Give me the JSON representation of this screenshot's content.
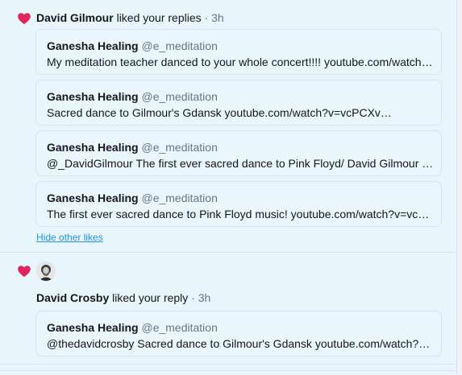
{
  "colors": {
    "background": "#e8f5fd",
    "heart": "#e0245e",
    "link": "#1b95e0",
    "muted": "#657786"
  },
  "notifications": [
    {
      "icon": "heart-icon",
      "user": "David Gilmour",
      "action": "liked your replies",
      "dot": "·",
      "time": "3h",
      "tweets": [
        {
          "name": "Ganesha Healing",
          "handle": "@e_meditation",
          "text": "My meditation teacher danced to your whole concert!!!! youtube.com/watch…"
        },
        {
          "name": "Ganesha Healing",
          "handle": "@e_meditation",
          "text": "Sacred dance to Gilmour's Gdansk youtube.com/watch?v=vcPCXv…"
        },
        {
          "name": "Ganesha Healing",
          "handle": "@e_meditation",
          "text": "@_DavidGilmour The first ever sacred dance to Pink Floyd/ David Gilmour m…"
        },
        {
          "name": "Ganesha Healing",
          "handle": "@e_meditation",
          "text": "The first ever sacred dance to Pink Floyd music! youtube.com/watch?v=vcPC…"
        }
      ],
      "hide_link": "Hide other likes"
    },
    {
      "icon": "heart-icon",
      "avatar": "avatar",
      "user": "David Crosby",
      "action": "liked your reply",
      "dot": "·",
      "time": "3h",
      "tweets": [
        {
          "name": "Ganesha Healing",
          "handle": "@e_meditation",
          "text": "@thedavidcrosby Sacred dance to Gilmour's Gdansk youtube.com/watch?v=…"
        }
      ]
    }
  ]
}
